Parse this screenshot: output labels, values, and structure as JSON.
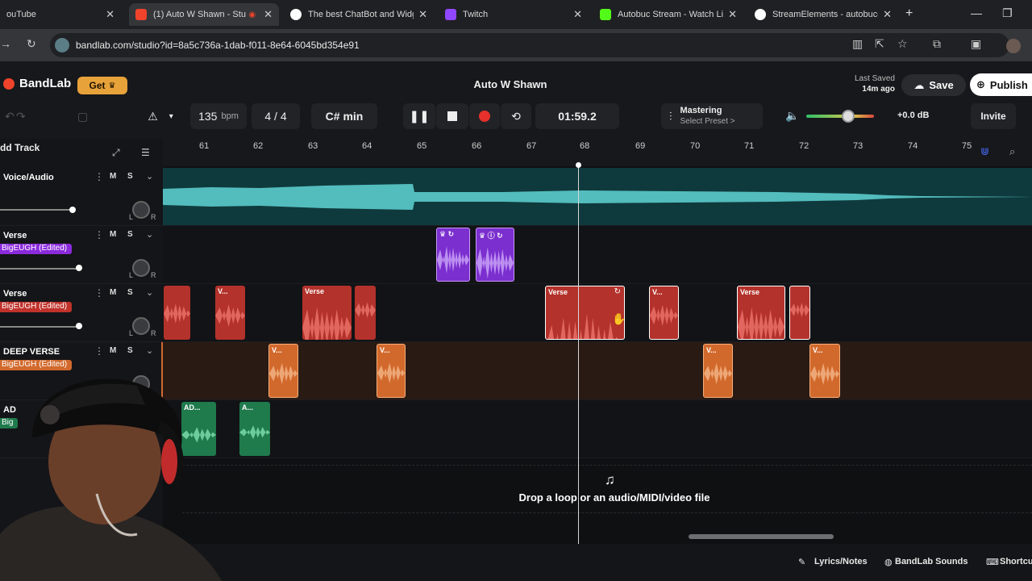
{
  "browser": {
    "tabs": [
      {
        "title": "ouTube",
        "active": false,
        "favicon_color": "#ff0000"
      },
      {
        "title": "(1) Auto W Shawn - Stu",
        "active": true,
        "favicon_color": "#f0432b"
      },
      {
        "title": "The best ChatBot and Widg",
        "active": false,
        "favicon_color": "#ffffff"
      },
      {
        "title": "Twitch",
        "active": false,
        "favicon_color": "#9146ff"
      },
      {
        "title": "Autobuc Stream - Watch Li",
        "active": false,
        "favicon_color": "#53fc18"
      },
      {
        "title": "StreamElements - autobucc",
        "active": false,
        "favicon_color": "#ffffff"
      }
    ],
    "new_tab": "+",
    "url": "bandlab.com/studio?id=8a5c736a-1dab-f011-8e64-6045bd354e91"
  },
  "header": {
    "brand": "BandLab",
    "get_label": "Get",
    "project_title": "Auto W Shawn",
    "last_saved_label": "Last Saved",
    "last_saved_value": "14m ago",
    "save_label": "Save",
    "publish_label": "Publish"
  },
  "transport": {
    "bpm": "135",
    "bpm_unit": "bpm",
    "time_sig": "4 / 4",
    "key": "C# min",
    "time": "01:59.2",
    "mastering_label": "Mastering",
    "mastering_preset": "Select Preset >",
    "gain": "+0.0 dB",
    "invite_label": "Invite",
    "volume_level": 0.62
  },
  "left": {
    "add_track_label": "dd Track"
  },
  "ruler": {
    "bars": [
      "61",
      "62",
      "63",
      "64",
      "65",
      "66",
      "67",
      "68",
      "69",
      "70",
      "71",
      "72",
      "73",
      "74",
      "75"
    ]
  },
  "tracks": [
    {
      "name": "Voice/Audio",
      "fx": "",
      "fx_color": "",
      "m": "M",
      "s": "S"
    },
    {
      "name": "Verse",
      "fx": "BigEUGH (Edited)",
      "fx_color": "#8b2bdb",
      "m": "M",
      "s": "S"
    },
    {
      "name": "Verse",
      "fx": "BigEUGH (Edited)",
      "fx_color": "#c0322b",
      "m": "M",
      "s": "S"
    },
    {
      "name": "DEEP VERSE",
      "fx": "BigEUGH (Edited)",
      "fx_color": "#d2692c",
      "m": "M",
      "s": "S"
    },
    {
      "name": "AD",
      "fx": "Big",
      "fx_color": "#1f7a4c",
      "m": "",
      "s": ""
    }
  ],
  "clips": {
    "red_labels": [
      "V...",
      "Verse",
      "Verse",
      "V...",
      "Verse"
    ],
    "orange_labels": [
      "V...",
      "V...",
      "V...",
      "V..."
    ],
    "green_labels": [
      "AD...",
      "A..."
    ]
  },
  "dropzone": {
    "text": "Drop a loop or an audio/MIDI/video file"
  },
  "bottom": {
    "lyrics": "Lyrics/Notes",
    "sounds": "BandLab Sounds",
    "shortcuts": "Shortcu"
  }
}
